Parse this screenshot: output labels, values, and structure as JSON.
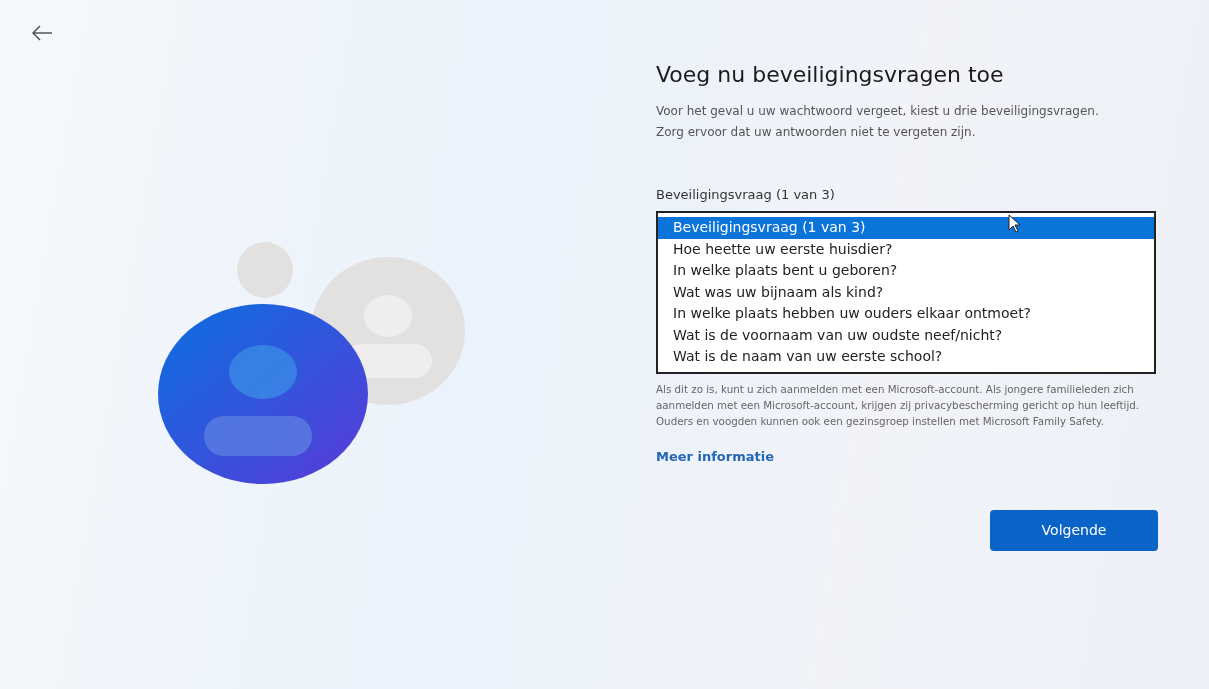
{
  "page": {
    "title": "Voeg nu beveiligingsvragen toe",
    "description": "Voor het geval u uw wachtwoord vergeet, kiest u drie beveiligingsvragen. Zorg ervoor dat uw antwoorden niet te vergeten zijn."
  },
  "question_field": {
    "label": "Beveiligingsvraag (1 van 3)",
    "options": [
      {
        "label": "Beveiligingsvraag (1 van 3)",
        "selected": true
      },
      {
        "label": "Hoe heette uw eerste huisdier?",
        "selected": false
      },
      {
        "label": "In welke plaats bent u geboren?",
        "selected": false
      },
      {
        "label": "Wat was uw bijnaam als kind?",
        "selected": false
      },
      {
        "label": "In welke plaats hebben uw ouders elkaar ontmoet?",
        "selected": false
      },
      {
        "label": "Wat is de voornaam van uw oudste neef/nicht?",
        "selected": false
      },
      {
        "label": "Wat is de naam van uw eerste school?",
        "selected": false
      }
    ]
  },
  "info": {
    "text": "Als dit zo is, kunt u zich aanmelden met een Microsoft-account. Als jongere familieleden zich aanmelden met een Microsoft-account, krijgen zij privacybescherming gericht op hun leeftijd. Ouders en voogden kunnen ook een gezinsgroep instellen met Microsoft Family Safety.",
    "link": "Meer informatie"
  },
  "buttons": [
    {
      "label": "Volgende"
    }
  ]
}
